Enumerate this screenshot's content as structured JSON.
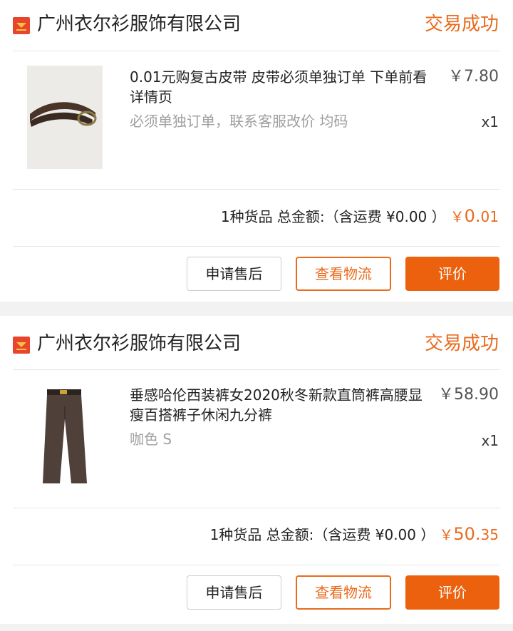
{
  "orders": [
    {
      "shop_name": "广州衣尔衫服饰有限公司",
      "status": "交易成功",
      "product": {
        "title": "0.01元购复古皮带 皮带必须单独订单 下单前看详情页",
        "spec": "必须单独订单，联系客服改价 均码",
        "price": "￥7.80",
        "qty": "x1",
        "image_icon": "belt-image"
      },
      "summary": {
        "text": "1种货品 总金额:（含运费 ¥0.00 ）",
        "currency": "￥",
        "total_int": "0.",
        "total_dec": "01"
      },
      "buttons": {
        "after_sales": "申请售后",
        "logistics": "查看物流",
        "review": "评价"
      }
    },
    {
      "shop_name": "广州衣尔衫服饰有限公司",
      "status": "交易成功",
      "product": {
        "title": "垂感哈伦西装裤女2020秋冬新款直筒裤高腰显瘦百搭裤子休闲九分裤",
        "spec": "咖色 S",
        "price": "￥58.90",
        "qty": "x1",
        "image_icon": "trousers-image"
      },
      "summary": {
        "text": "1种货品 总金额:（含运费 ¥0.00 ）",
        "currency": "￥",
        "total_int": "50.",
        "total_dec": "35"
      },
      "buttons": {
        "after_sales": "申请售后",
        "logistics": "查看物流",
        "review": "评价"
      }
    }
  ],
  "colors": {
    "accent": "#ea6a1c",
    "button_fill": "#ec610d",
    "shop_icon_bg": "#e8452c",
    "shop_icon_fg": "#f6c343"
  }
}
